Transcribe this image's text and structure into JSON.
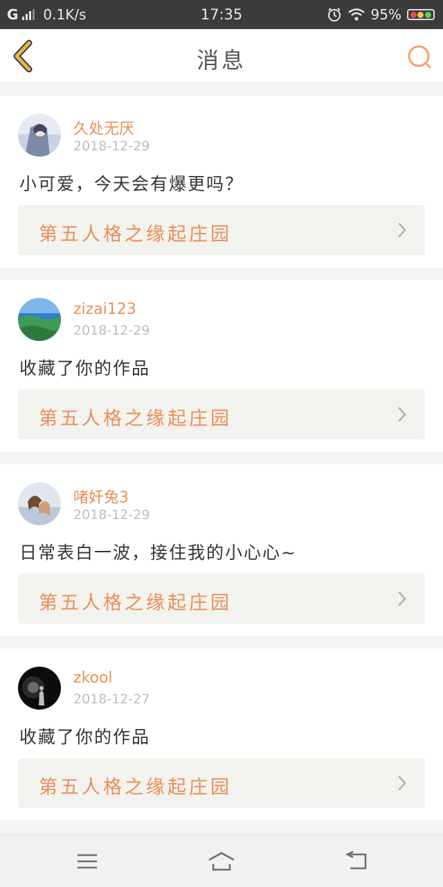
{
  "status_bar": {
    "network": "G",
    "speed": "0.1K/s",
    "time": "17:35",
    "battery": "95%"
  },
  "header": {
    "title": "消息"
  },
  "colors": {
    "accent": "#e88f58",
    "back_arrow": "#e2b64a",
    "search": "#f2a06a"
  },
  "messages": [
    {
      "username": "久处无厌",
      "date": "2018-12-29",
      "text": "小可爱，今天会有爆更吗？",
      "work": "第五人格之缘起庄园",
      "avatar": "avatar-girl-gray"
    },
    {
      "username": "zizai123",
      "date": "2018-12-29",
      "text": "收藏了你的作品",
      "work": "第五人格之缘起庄园",
      "avatar": "avatar-landscape"
    },
    {
      "username": "啫奷兔3",
      "date": "2018-12-29",
      "text": "日常表白一波，接住我的小心心~",
      "work": "第五人格之缘起庄园",
      "avatar": "avatar-couple"
    },
    {
      "username": "zkool",
      "date": "2018-12-27",
      "text": "收藏了你的作品",
      "work": "第五人格之缘起庄园",
      "avatar": "avatar-night"
    }
  ],
  "nav": {
    "menu_icon": "menu-icon",
    "home_icon": "home-icon",
    "back_icon": "back-icon"
  }
}
